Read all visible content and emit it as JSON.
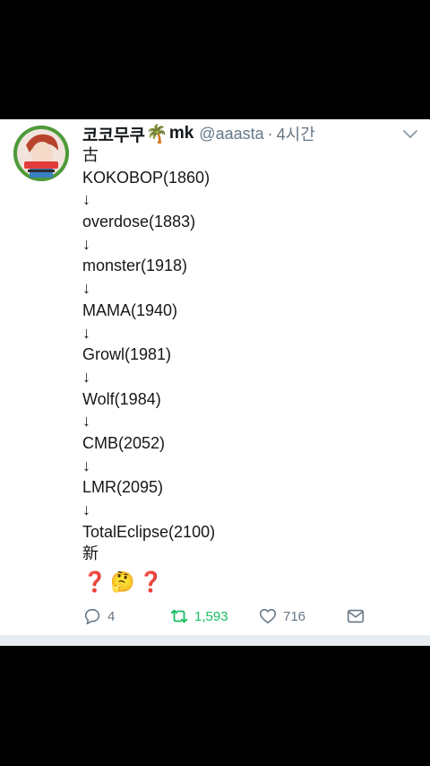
{
  "tweet": {
    "display_name": "코코무쿠",
    "display_name_suffix": "mk",
    "handle": "@aaasta",
    "separator": "·",
    "time": "4시간",
    "lines": [
      "古",
      "KOKOBOP(1860)",
      "↓",
      "overdose(1883)",
      "↓",
      "monster(1918)",
      "↓",
      "MAMA(1940)",
      "↓",
      "Growl(1981)",
      "↓",
      "Wolf(1984)",
      "↓",
      "CMB(2052)",
      "↓",
      "LMR(2095)",
      "↓",
      "TotalEclipse(2100)",
      "新"
    ],
    "emoji_line": {
      "first": "❓",
      "middle": "🤔",
      "last": "❓"
    },
    "replies": "4",
    "retweets": "1,593",
    "likes": "716"
  },
  "icons": {
    "palm": "palm-tree-icon",
    "chevron": "chevron-down-icon",
    "reply": "reply-icon",
    "retweet": "retweet-icon",
    "like": "heart-icon",
    "dm": "mail-icon"
  },
  "colors": {
    "text": "#14171a",
    "muted": "#657786",
    "retweet_active": "#17bf63",
    "card_bg": "#ffffff",
    "separator": "#e6ecf0"
  }
}
